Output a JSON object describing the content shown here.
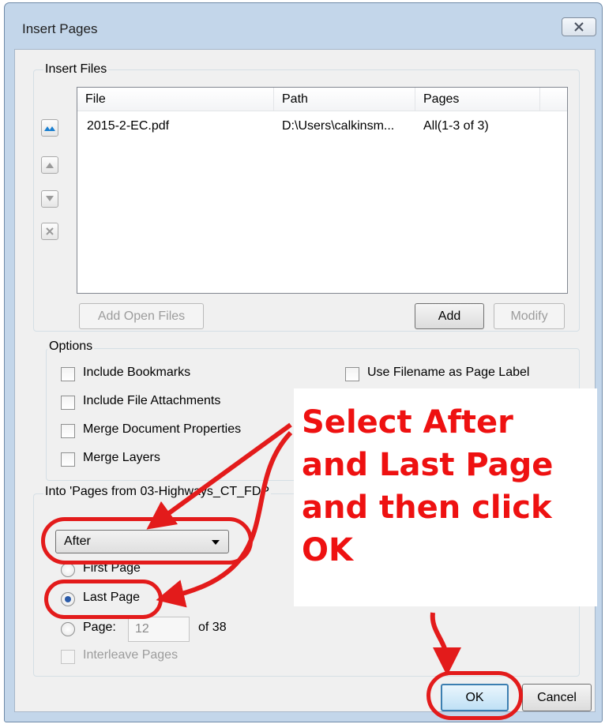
{
  "window": {
    "title": "Insert Pages"
  },
  "insert_files": {
    "legend": "Insert Files",
    "columns": [
      "File",
      "Path",
      "Pages"
    ],
    "rows": [
      {
        "file": "2015-2-EC.pdf",
        "path": "D:\\Users\\calkinsm...",
        "pages": "All(1-3 of 3)"
      }
    ],
    "buttons": {
      "add_open_files": "Add Open Files",
      "add": "Add",
      "modify": "Modify"
    }
  },
  "options": {
    "legend": "Options",
    "include_bookmarks": "Include Bookmarks",
    "include_file_attachments": "Include File Attachments",
    "merge_document_properties": "Merge Document Properties",
    "merge_layers": "Merge Layers",
    "use_filename_as_page_label": "Use Filename as Page Label"
  },
  "into": {
    "legend": "Into 'Pages from 03-Highways_CT_FDP",
    "position_selected": "After",
    "first_page": "First Page",
    "last_page": "Last Page",
    "page_label": "Page:",
    "page_value": "12",
    "of_total": "of 38",
    "interleave_pages": "Interleave Pages",
    "selected_option": "Last Page"
  },
  "footer": {
    "ok": "OK",
    "cancel": "Cancel"
  },
  "annotation": {
    "lines": [
      "Select After",
      "and Last Page",
      "and then click",
      "OK"
    ],
    "color": "#ee1111"
  },
  "icons": {
    "close": "close-icon",
    "move_top": "move-to-top-icon",
    "move_up": "move-up-icon",
    "move_down": "move-down-icon",
    "remove": "remove-icon",
    "dropdown": "chevron-down-icon"
  }
}
